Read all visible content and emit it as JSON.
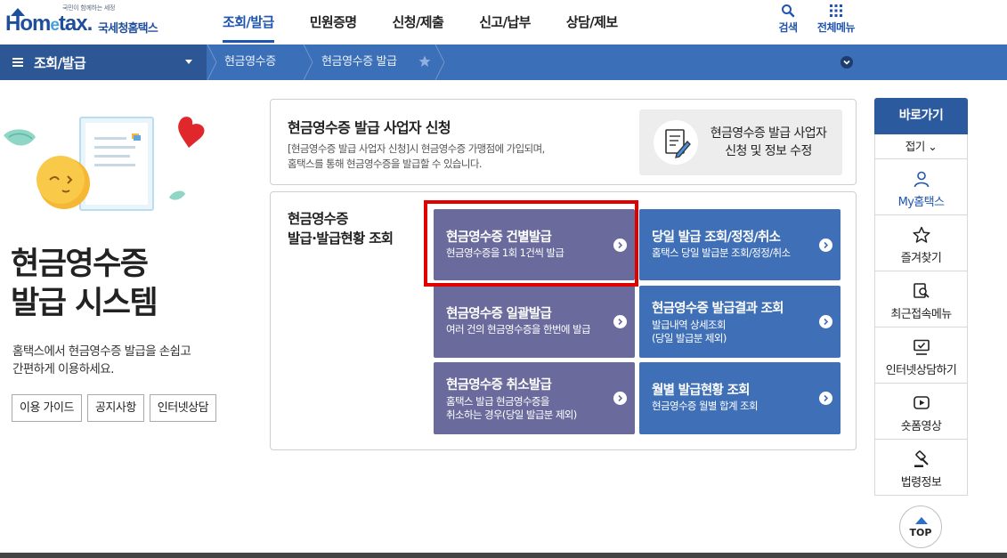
{
  "header": {
    "logo_sub": "국민이 함께하는 세정",
    "logo_home": "Hom",
    "logo_e": "e",
    "logo_tax": "tax.",
    "logo_kr": "국세청홈택스",
    "nav": [
      "조회/발급",
      "민원증명",
      "신청/제출",
      "신고/납부",
      "상담/제보"
    ],
    "active_nav": "조회/발급",
    "search_label": "검색",
    "allmenu_label": "전체메뉴",
    "brand_color": "#1f55b0"
  },
  "breadcrumb": {
    "menu": "조회/발급",
    "items": [
      "현금영수증",
      "현금영수증 발급"
    ],
    "bar_color": "#3b6fb8"
  },
  "hero": {
    "title_line1": "현금영수증",
    "title_line2": "발급 시스템",
    "desc_line1": "홈택스에서 현금영수증 발급을 손쉽고",
    "desc_line2": "간편하게 이용하세요.",
    "buttons": [
      "이용 가이드",
      "공지사항",
      "인터넷상담"
    ]
  },
  "panel1": {
    "title": "현금영수증 발급 사업자 신청",
    "desc_line1": "[현금영수증 발급 사업자 신청]시 현금영수증 가맹점에 가입되며,",
    "desc_line2": "홈택스를 통해 현금영수증을 발급할 수 있습니다.",
    "button_line1": "현금영수증 발급 사업자",
    "button_line2": "신청 및 정보 수정"
  },
  "panel2": {
    "title_line1": "현금영수증",
    "title_line2": "발급·발급현황 조회",
    "tiles": [
      {
        "title": "현금영수증 건별발급",
        "desc1": "현금영수증을 1회 1건씩 발급",
        "desc2": "",
        "color": "#6a6a9c"
      },
      {
        "title": "당일 발급 조회/정정/취소",
        "desc1": "홈택스 당일 발급분 조회/정정/취소",
        "desc2": "",
        "color": "#3f6fb7"
      },
      {
        "title": "현금영수증 일괄발급",
        "desc1": "여러 건의 현금영수증을 한번에 발급",
        "desc2": "",
        "color": "#6a6a9c"
      },
      {
        "title": "현금영수증 발급결과 조회",
        "desc1": "발급내역 상세조회",
        "desc2": "(당일 발급분 제외)",
        "color": "#3f6fb7"
      },
      {
        "title": "현금영수증 취소발급",
        "desc1": "홈택스 발급 현금영수증을",
        "desc2": "취소하는 경우(당일 발급분 제외)",
        "color": "#6a6a9c"
      },
      {
        "title": "월별 발급현황 조회",
        "desc1": "현금영수증 월별 합계 조회",
        "desc2": "",
        "color": "#3f6fb7"
      }
    ],
    "highlight_color": "#e00000"
  },
  "quick": {
    "head": "바로가기",
    "fold": "접기 ⌄",
    "items": [
      "My홈택스",
      "즐겨찾기",
      "최근접속메뉴",
      "인터넷상담하기",
      "숏폼영상",
      "법령정보"
    ]
  },
  "top_button": "TOP"
}
